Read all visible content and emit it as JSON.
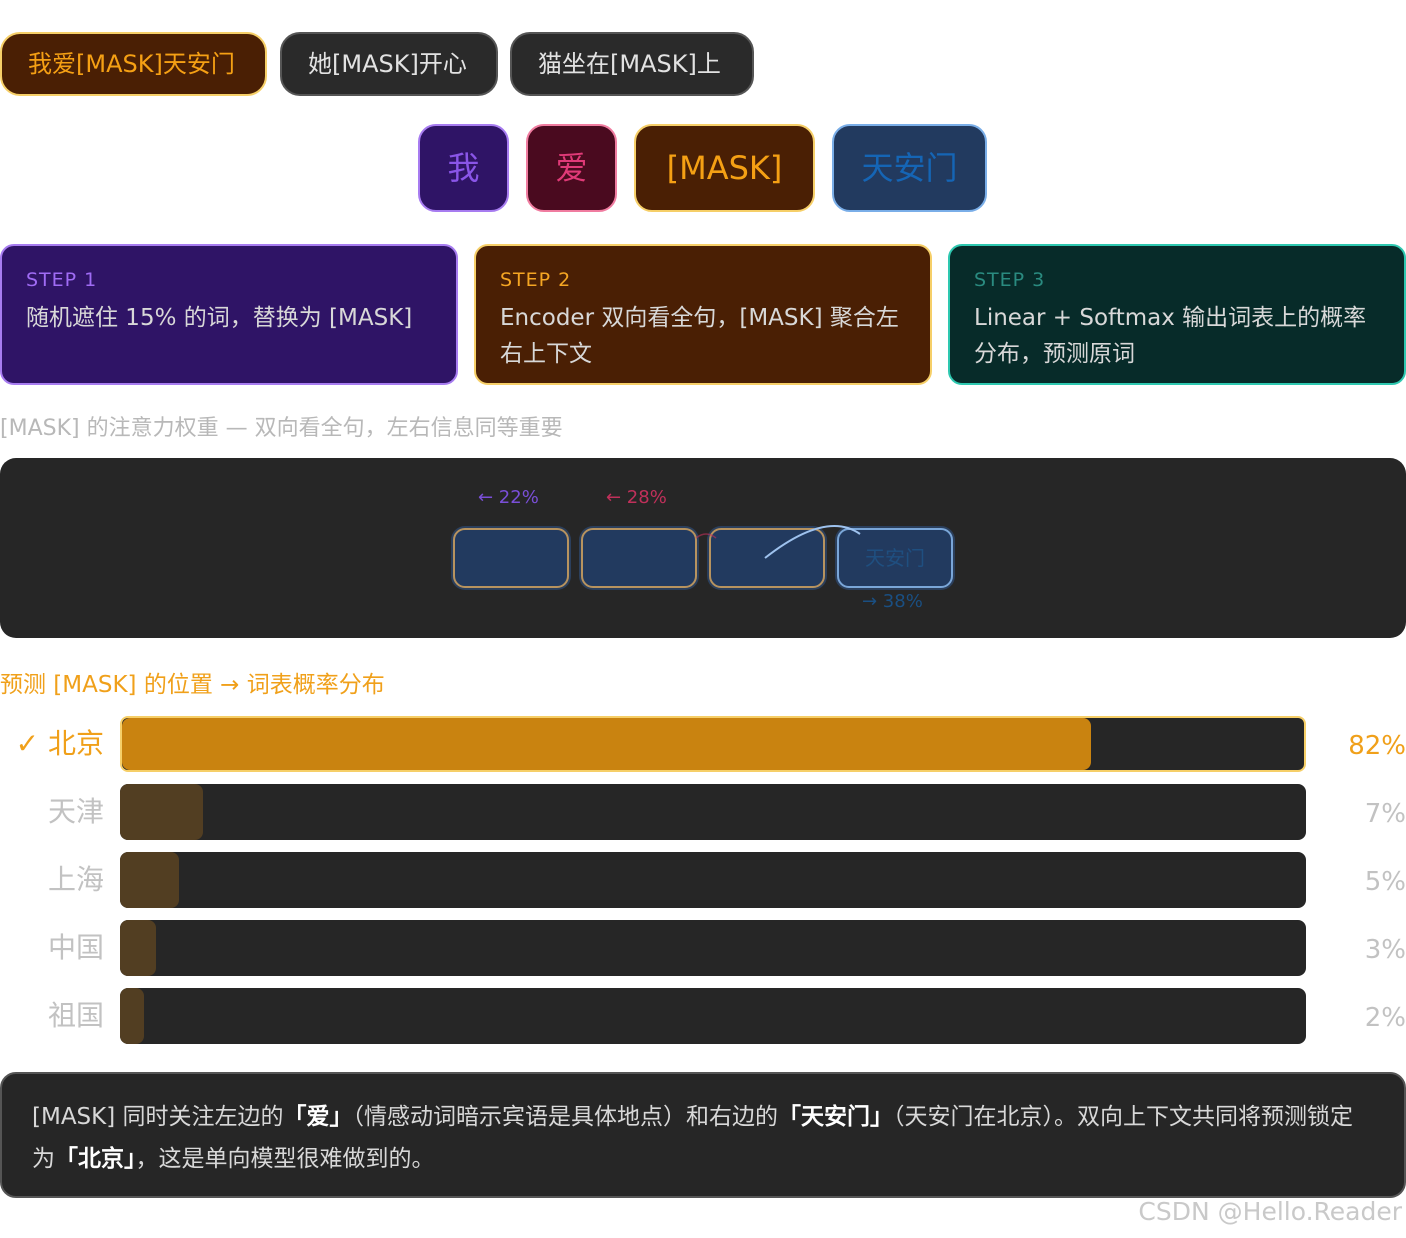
{
  "examples": [
    {
      "label": "我爱[MASK]天安门",
      "active": true
    },
    {
      "label": "她[MASK]开心",
      "active": false
    },
    {
      "label": "猫坐在[MASK]上",
      "active": false
    }
  ],
  "tokens": [
    {
      "text": "我",
      "bg": "#2f1466",
      "border": "#a77cf0",
      "color": "#8a55e8"
    },
    {
      "text": "爱",
      "bg": "#4a0a1f",
      "border": "#f07ca0",
      "color": "#e03a78"
    },
    {
      "text": "[MASK]",
      "bg": "#4a1f04",
      "border": "#f6cf68",
      "color": "#f5a014"
    },
    {
      "text": "天安门",
      "bg": "#223a5f",
      "border": "#7aaee8",
      "color": "#1565b5"
    }
  ],
  "steps": [
    {
      "num": "STEP 1",
      "text": "随机遮住 15% 的词，替换为 [MASK]"
    },
    {
      "num": "STEP 2",
      "text": "Encoder 双向看全句，[MASK] 聚合左右上下文"
    },
    {
      "num": "STEP 3",
      "text": "Linear + Softmax 输出词表上的概率分布，预测原词"
    }
  ],
  "attention": {
    "caption": "[MASK] 的注意力权重 — 双向看全句，左右信息同等重要",
    "boxes": [
      "",
      "",
      "",
      "天安门"
    ],
    "weights": [
      {
        "label": "← 22%",
        "color": "#7a4fd8"
      },
      {
        "label": "← 28%",
        "color": "#c0305a"
      },
      {
        "label": "→ 38%",
        "color": "#1a4f82"
      }
    ]
  },
  "prediction": {
    "caption": "预测 [MASK] 的位置 → 词表概率分布",
    "candidates": [
      {
        "label": "✓ 北京",
        "value": 0.82,
        "pct": "82%",
        "top": true
      },
      {
        "label": "天津",
        "value": 0.07,
        "pct": "7%",
        "top": false
      },
      {
        "label": "上海",
        "value": 0.05,
        "pct": "5%",
        "top": false
      },
      {
        "label": "中国",
        "value": 0.03,
        "pct": "3%",
        "top": false
      },
      {
        "label": "祖国",
        "value": 0.02,
        "pct": "2%",
        "top": false
      }
    ]
  },
  "note": {
    "p1": "[MASK] 同时关注左边的",
    "b1": "「爱」",
    "p2": "（情感动词暗示宾语是具体地点）和右边的",
    "b2": "「天安门」",
    "p3": "（天安门在北京）。双向上下文共同将预测锁定为",
    "b3": "「北京」",
    "p4": "，这是单向模型很难做到的。"
  },
  "watermark": "CSDN @Hello.Reader",
  "colors": {
    "step1_bg": "#2f1466",
    "step1_border": "#a77cf0",
    "step1_num": "#a06cf5",
    "step2_bg": "#4a1f04",
    "step2_border": "#f6cf68",
    "step2_num": "#f5a623",
    "step3_bg": "#072b29",
    "step3_border": "#2ec8b0",
    "step3_num": "#2a8b80"
  }
}
